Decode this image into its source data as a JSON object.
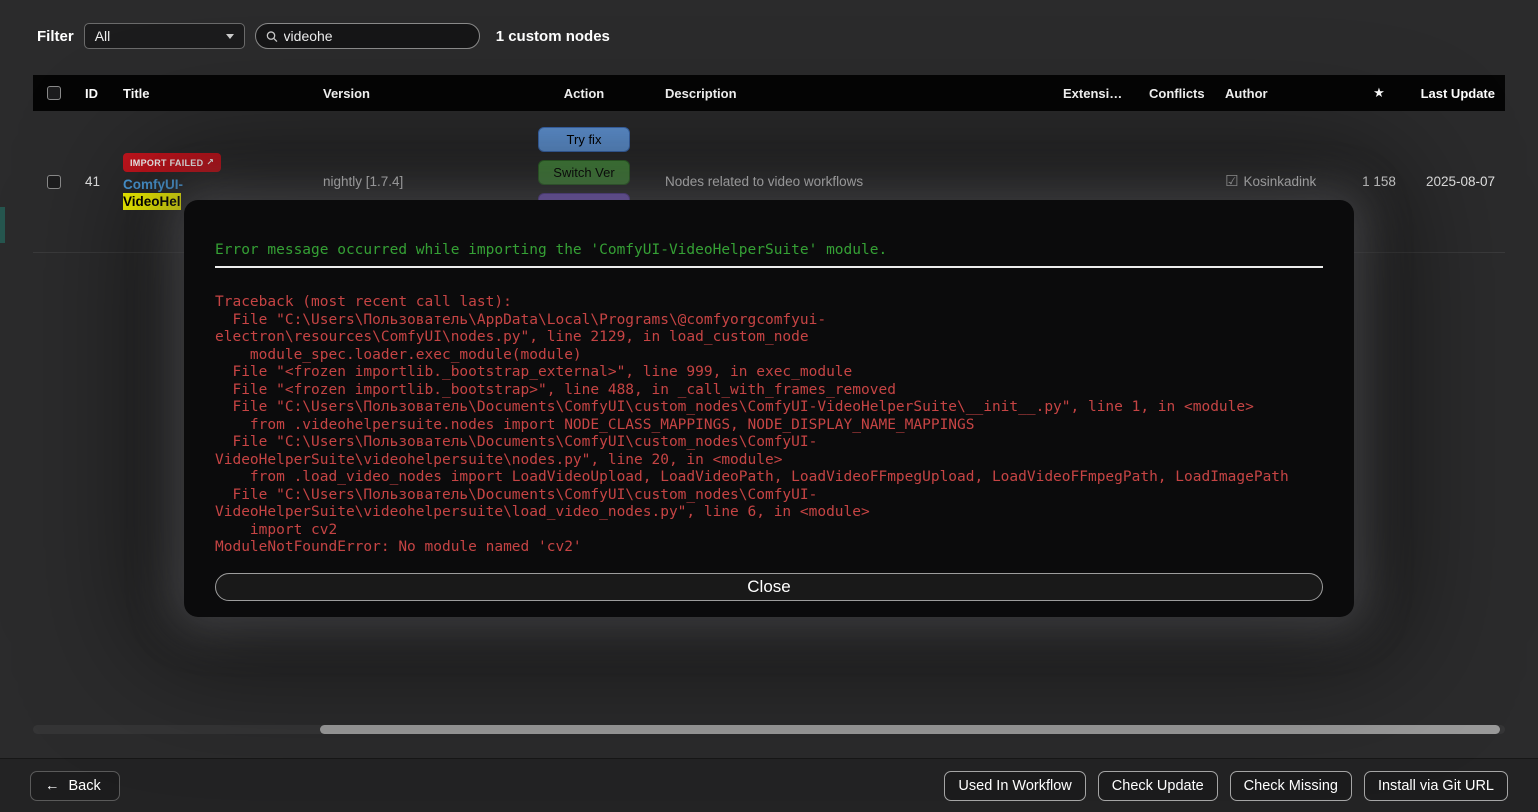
{
  "filter_bar": {
    "label": "Filter",
    "dropdown_value": "All",
    "search_value": "videohe",
    "count_text": "1 custom nodes"
  },
  "table": {
    "headers": {
      "id": "ID",
      "title": "Title",
      "version": "Version",
      "action": "Action",
      "description": "Description",
      "extension": "Extensi…",
      "conflicts": "Conflicts",
      "author": "Author",
      "star": "★",
      "last_update": "Last Update"
    },
    "row": {
      "id": "41",
      "badge_label": "IMPORT FAILED",
      "badge_icon": "↗",
      "title_line1": "ComfyUI-",
      "title_highlight": "VideoHel",
      "version": "nightly [1.7.4]",
      "action_try_fix": "Try fix",
      "action_switch_ver": "Switch Ver",
      "description": "Nodes related to video workflows",
      "author_verified_icon": "☑",
      "author": "Kosinkadink",
      "stars": "1 158",
      "last_update": "2025-08-07"
    }
  },
  "modal": {
    "title": "Error message occurred while importing the 'ComfyUI-VideoHelperSuite' module.",
    "traceback_lines": [
      "Traceback (most recent call last):",
      "  File \"C:\\Users\\Пользователь\\AppData\\Local\\Programs\\@comfyorgcomfyui-",
      "electron\\resources\\ComfyUI\\nodes.py\", line 2129, in load_custom_node",
      "    module_spec.loader.exec_module(module)",
      "  File \"<frozen importlib._bootstrap_external>\", line 999, in exec_module",
      "  File \"<frozen importlib._bootstrap>\", line 488, in _call_with_frames_removed",
      "  File \"C:\\Users\\Пользователь\\Documents\\ComfyUI\\custom_nodes\\ComfyUI-VideoHelperSuite\\__init__.py\", line 1, in <module>",
      "    from .videohelpersuite.nodes import NODE_CLASS_MAPPINGS, NODE_DISPLAY_NAME_MAPPINGS",
      "  File \"C:\\Users\\Пользователь\\Documents\\ComfyUI\\custom_nodes\\ComfyUI-",
      "VideoHelperSuite\\videohelpersuite\\nodes.py\", line 20, in <module>",
      "    from .load_video_nodes import LoadVideoUpload, LoadVideoPath, LoadVideoFFmpegUpload, LoadVideoFFmpegPath, LoadImagePath",
      "  File \"C:\\Users\\Пользователь\\Documents\\ComfyUI\\custom_nodes\\ComfyUI-",
      "VideoHelperSuite\\videohelpersuite\\load_video_nodes.py\", line 6, in <module>",
      "    import cv2",
      "ModuleNotFoundError: No module named 'cv2'"
    ],
    "close_label": "Close"
  },
  "footer": {
    "back_icon": "←",
    "back_label": "Back",
    "buttons": [
      "Used In Workflow",
      "Check Update",
      "Check Missing",
      "Install via Git URL"
    ]
  },
  "colors": {
    "accent_blue": "#649add",
    "accent_green": "#4a9140",
    "accent_purple": "#7e5cd0",
    "error_red": "#c64444",
    "success_green": "#35a035",
    "badge_red": "#c9151e",
    "highlight_yellow": "#ffff00"
  }
}
